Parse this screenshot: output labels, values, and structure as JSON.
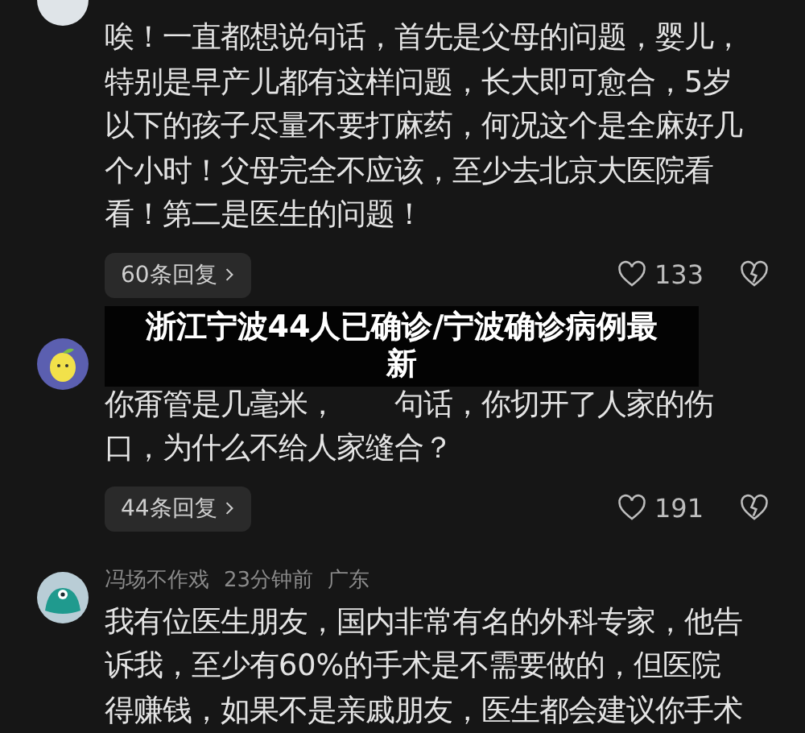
{
  "comments": [
    {
      "kind": "plain",
      "lines": [
        "唉！一直都想说句话，首先是父母的问题，婴儿，",
        "特别是早产儿都有这样问题，长大即可愈合，5岁",
        "以下的孩子尽量不要打麻药，何况这个是全麻好几",
        "个小时！父母完全不应该，至少去北京大医院看",
        "看！第二是医生的问题！"
      ],
      "replies": "60条回复",
      "likes": "133"
    },
    {
      "kind": "lemon",
      "lines": [
        "你甭管是几毫米，　　句话，你切开了人家的伤",
        "口，为什么不给人家缝合？"
      ],
      "replies": "44条回复",
      "likes": "191"
    },
    {
      "kind": "blob",
      "author": "冯场不作戏",
      "time": "23分钟前",
      "location": "广东",
      "lines": [
        "我有位医生朋友，国内非常有名的外科专家，他告",
        "诉我，至少有60%的手术是不需要做的，但医院",
        "得赚钱，如果不是亲戚朋友，医生都会建议你手术"
      ]
    }
  ],
  "headline": "浙江宁波44人已确诊/宁波确诊病例最新"
}
